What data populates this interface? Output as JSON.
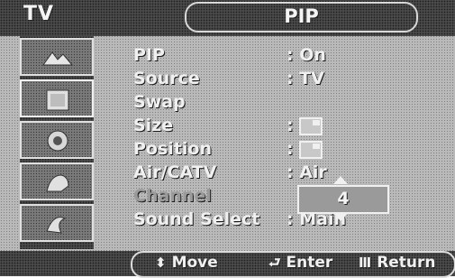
{
  "header": {
    "left_label": "TV",
    "title": "PIP"
  },
  "sidebar": {
    "icons": [
      "picture-icon",
      "sound-icon",
      "channel-icon",
      "setup-icon",
      "input-icon"
    ]
  },
  "menu": {
    "items": [
      {
        "label": "PIP",
        "value": ": On"
      },
      {
        "label": "Source",
        "value": ": TV"
      },
      {
        "label": "Swap",
        "value": ""
      },
      {
        "label": "Size",
        "value": ":"
      },
      {
        "label": "Position",
        "value": ":"
      },
      {
        "label": "Air/CATV",
        "value": ": Air"
      },
      {
        "label": "Channel",
        "value": ""
      },
      {
        "label": "Sound Select",
        "value": ": Main"
      }
    ]
  },
  "channel_popup": {
    "value": "4"
  },
  "footer": {
    "move": "Move",
    "enter": "Enter",
    "return": "Return"
  }
}
